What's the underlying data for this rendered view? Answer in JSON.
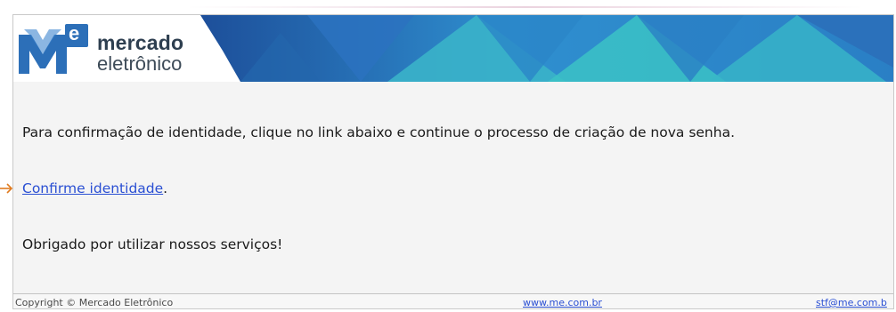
{
  "colors": {
    "banner_dark": "#1d4f9a",
    "banner_mid": "#2f8fcf",
    "banner_teal": "#3bc2c6",
    "logo_blue": "#2c6fb8",
    "link": "#2a4fd3",
    "arrow": "#e07b20"
  },
  "header": {
    "logo_letter": "e",
    "logo_line1": "mercado",
    "logo_line2": "eletrônico"
  },
  "body": {
    "paragraph1": "Para confirmação de identidade, clique no link abaixo e continue o processo de criação de nova senha.",
    "link_text": "Confirme identidade",
    "link_suffix": ".",
    "paragraph3": "Obrigado por utilizar nossos serviços!"
  },
  "footer": {
    "copyright": "Copyright © Mercado Eletrônico",
    "website": "www.me.com.br",
    "email": "stf@me.com.b"
  }
}
